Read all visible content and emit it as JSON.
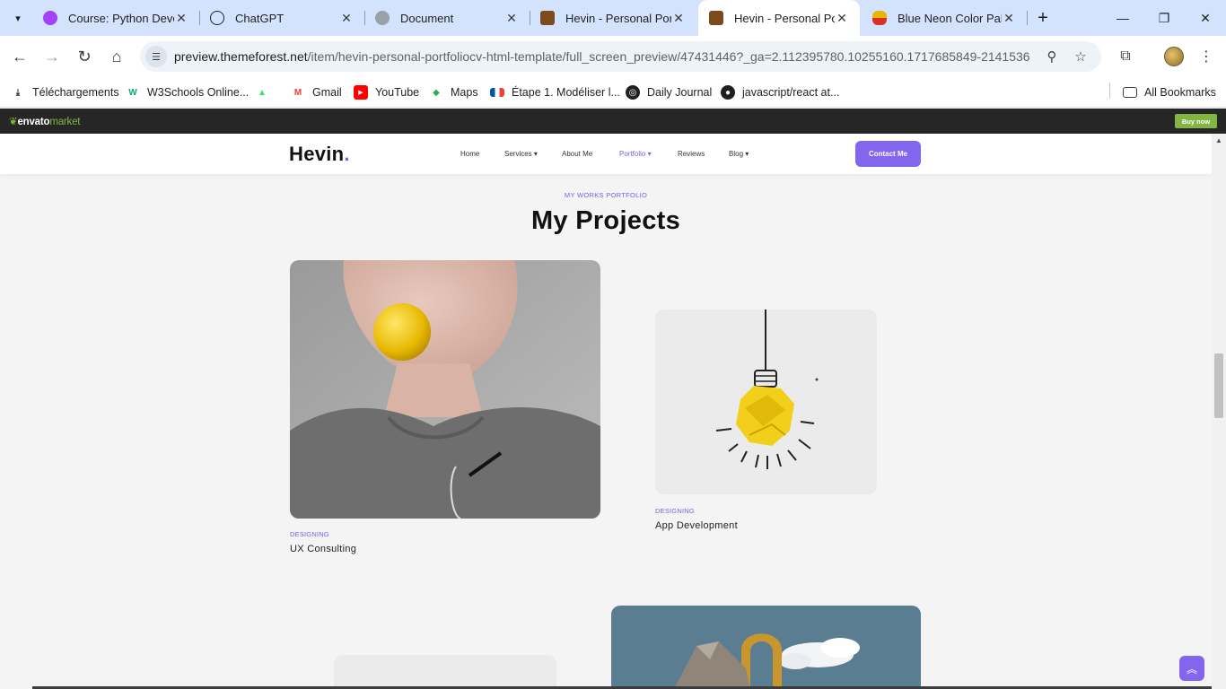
{
  "browser": {
    "tabs": [
      {
        "title": "Course: Python Devel",
        "active": false,
        "favicon_color": "#a142f4"
      },
      {
        "title": "ChatGPT",
        "active": false,
        "favicon_color": "#1f1f1f"
      },
      {
        "title": "Document",
        "active": false,
        "favicon_color": "#5f6368"
      },
      {
        "title": "Hevin - Personal Port",
        "active": false,
        "favicon_color": "#7b4a1d"
      },
      {
        "title": "Hevin - Personal Port",
        "active": true,
        "favicon_color": "#7b4a1d"
      },
      {
        "title": "Blue Neon Color Pale",
        "active": false,
        "favicon_color": "#e5b700"
      }
    ],
    "url_host": "preview.themeforest.net",
    "url_path": "/item/hevin-personal-portfoliocv-html-template/full_screen_preview/47431446?_ga=2.112395780.10255160.1717685849-2141536...",
    "bookmarks": [
      {
        "label": "Téléchargements",
        "icon": "download-icon"
      },
      {
        "label": "W3Schools Online...",
        "icon": "w3schools-icon"
      },
      {
        "label": "",
        "icon": "android-icon"
      },
      {
        "label": "Gmail",
        "icon": "gmail-icon"
      },
      {
        "label": "YouTube",
        "icon": "youtube-icon"
      },
      {
        "label": "Maps",
        "icon": "maps-icon"
      },
      {
        "label": "Étape 1. Modéliser l...",
        "icon": "flag-fr-icon"
      },
      {
        "label": "Daily Journal",
        "icon": "globe-icon"
      },
      {
        "label": "javascript/react at...",
        "icon": "github-icon"
      }
    ],
    "all_bookmarks": "All Bookmarks"
  },
  "envato": {
    "logo": "envato",
    "logo_market": "market",
    "buy_now": "Buy now"
  },
  "site": {
    "brand": "Hevin",
    "brand_dot": ".",
    "nav": {
      "home": "Home",
      "services": "Services",
      "about": "About Me",
      "portfolio": "Portfolio",
      "reviews": "Reviews",
      "blog": "Blog"
    },
    "contact": "Contact Me"
  },
  "section": {
    "kicker": "MY WORKS PORTFOLIO",
    "heading": "My Projects"
  },
  "projects": [
    {
      "category": "DESIGNING",
      "title": "UX Consulting"
    },
    {
      "category": "DESIGNING",
      "title": "App Development"
    }
  ],
  "colors": {
    "accent": "#8366ee",
    "envato_green": "#82b541",
    "tab_strip": "#d3e3fd"
  }
}
